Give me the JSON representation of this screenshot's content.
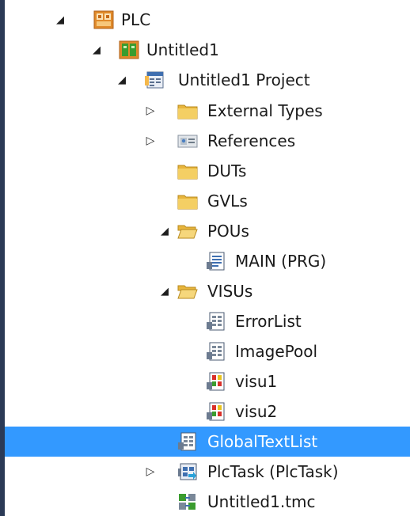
{
  "tree": {
    "plc": {
      "label": "PLC",
      "icon": "plc-project-icon"
    },
    "untitled1": {
      "label": "Untitled1",
      "icon": "plc-instance-icon"
    },
    "untitled1_project": {
      "label": "Untitled1 Project",
      "icon": "project-icon"
    },
    "external_types": {
      "label": "External Types",
      "icon": "folder-icon"
    },
    "references": {
      "label": "References",
      "icon": "references-icon"
    },
    "duts": {
      "label": "DUTs",
      "icon": "folder-icon"
    },
    "gvls": {
      "label": "GVLs",
      "icon": "folder-icon"
    },
    "pous": {
      "label": "POUs",
      "icon": "open-folder-icon"
    },
    "main_prg": {
      "label": "MAIN (PRG)",
      "icon": "program-icon"
    },
    "visus": {
      "label": "VISUs",
      "icon": "open-folder-icon"
    },
    "errorlist": {
      "label": "ErrorList",
      "icon": "text-list-icon"
    },
    "imagepool": {
      "label": "ImagePool",
      "icon": "text-list-icon"
    },
    "visu1": {
      "label": "visu1",
      "icon": "visualization-icon"
    },
    "visu2": {
      "label": "visu2",
      "icon": "visualization-icon"
    },
    "globaltextlist": {
      "label": "GlobalTextList",
      "icon": "text-list-icon",
      "selected": true
    },
    "plctask": {
      "label": "PlcTask (PlcTask)",
      "icon": "task-icon"
    },
    "untitled1_tmc": {
      "label": "Untitled1.tmc",
      "icon": "tmc-file-icon"
    }
  },
  "colors": {
    "selection": "#3399ff",
    "left_edge": "#2b3a56"
  }
}
